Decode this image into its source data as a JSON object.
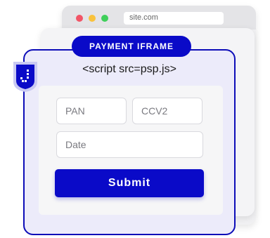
{
  "browser": {
    "url": "site.com",
    "dots": {
      "red": "#f25567",
      "yellow": "#f9c23c",
      "green": "#3fcf5a"
    }
  },
  "iframe": {
    "label": "PAYMENT IFRAME",
    "script": "<script src=psp.js>",
    "accent_color": "#0a0ac8",
    "icon": "shield-icon"
  },
  "form": {
    "pan_placeholder": "PAN",
    "ccv_placeholder": "CCV2",
    "date_placeholder": "Date",
    "submit_label": "Submit"
  }
}
